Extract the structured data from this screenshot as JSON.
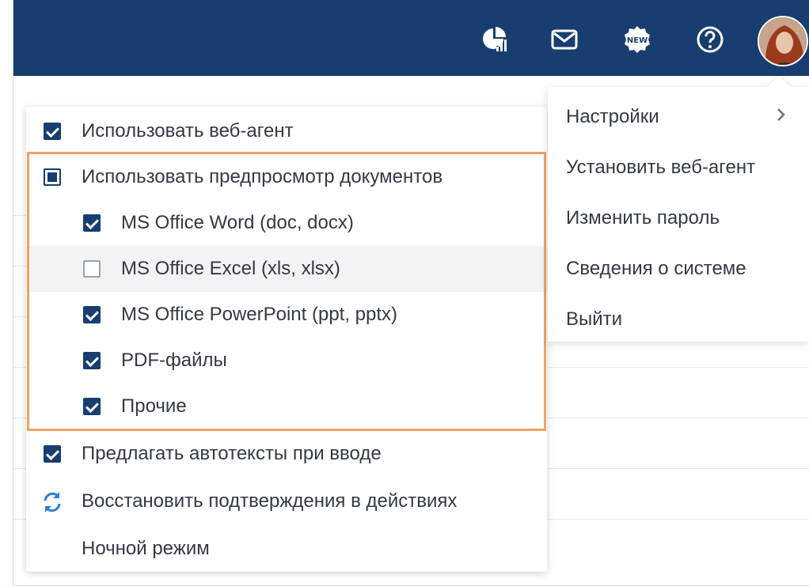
{
  "header": {
    "icons": [
      "reports-chart-icon",
      "mail-icon",
      "new-badge-icon",
      "help-icon"
    ],
    "avatar": "user-avatar"
  },
  "settings_menu": {
    "use_web_agent": {
      "label": "Использовать веб-агент",
      "checked": true
    },
    "use_preview": {
      "label": "Использовать предпросмотр документов",
      "state": "partial"
    },
    "preview_types": [
      {
        "label": "MS Office Word (doc, docx)",
        "checked": true
      },
      {
        "label": "MS Office Excel (xls, xlsx)",
        "checked": false
      },
      {
        "label": "MS Office PowerPoint (ppt, pptx)",
        "checked": true
      },
      {
        "label": "PDF-файлы",
        "checked": true
      },
      {
        "label": "Прочие",
        "checked": true
      }
    ],
    "suggest_autotext": {
      "label": "Предлагать автотексты при вводе",
      "checked": true
    },
    "restore_confirmations": {
      "label": "Восстановить подтверждения в действиях",
      "icon": "refresh-icon"
    },
    "night_mode": {
      "label": "Ночной режим"
    }
  },
  "profile_menu": {
    "items": [
      {
        "label": "Настройки",
        "has_submenu": true
      },
      {
        "label": "Установить веб-агент"
      },
      {
        "label": "Изменить пароль"
      },
      {
        "label": "Сведения о системе"
      },
      {
        "label": "Выйти"
      }
    ]
  },
  "colors": {
    "header_bg": "#173e6e",
    "checkbox": "#173e6e",
    "highlight_border": "#f0a261",
    "refresh_icon": "#2f7fd6"
  }
}
